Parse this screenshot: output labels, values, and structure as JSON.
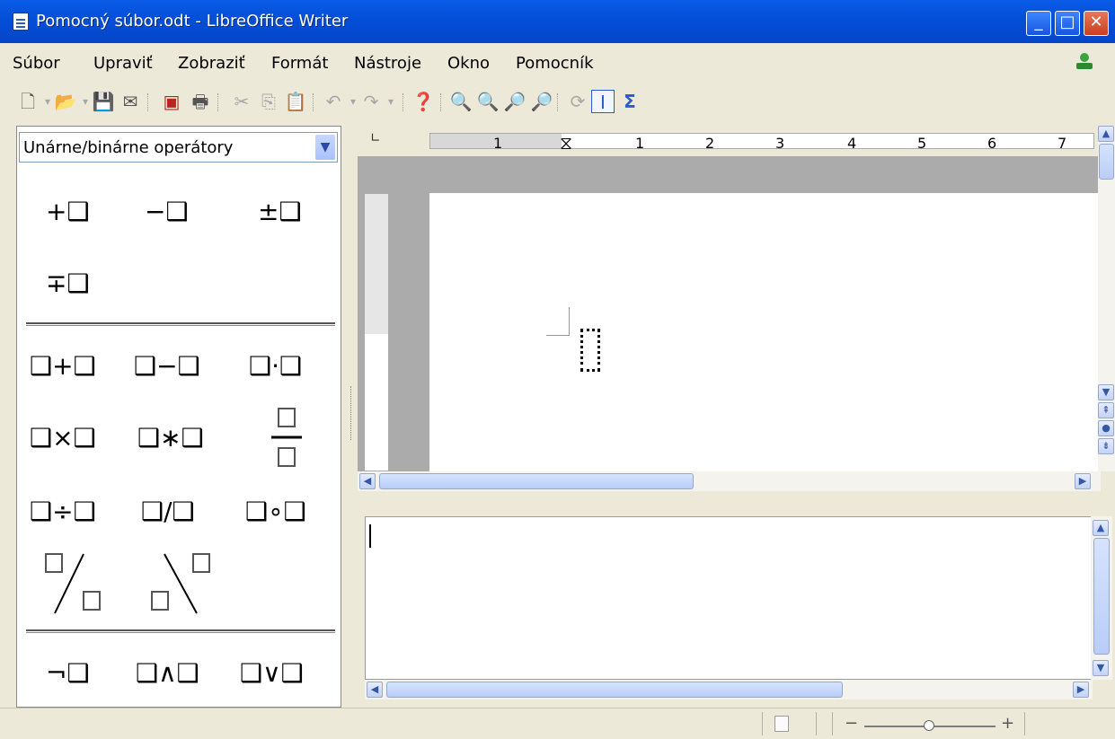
{
  "window": {
    "title": "Pomocný súbor.odt - LibreOffice Writer",
    "minimize": "_",
    "maximize": "□",
    "close": "✕"
  },
  "menu": [
    "Súbor",
    "Upraviť",
    "Zobraziť",
    "Formát",
    "Nástroje",
    "Okno",
    "Pomocník"
  ],
  "toolbar_icons": [
    "new-icon",
    "open-icon",
    "save-icon",
    "email-icon",
    "export-pdf-icon",
    "print-icon",
    "cut-icon",
    "copy-icon",
    "paste-icon",
    "undo-icon",
    "redo-icon",
    "help-icon",
    "zoom-in-icon",
    "zoom-out-icon",
    "zoom-100-icon",
    "zoom-page-icon",
    "update-icon",
    "formula-cursor-icon",
    "symbols-icon"
  ],
  "panel": {
    "category": "Unárne/binárne operátory",
    "unary": [
      "+❑",
      "−❑",
      "±❑",
      "∓❑"
    ],
    "binary": [
      "❑+❑",
      "❑−❑",
      "❑·❑",
      "❑×❑",
      "❑∗❑",
      "❑/❑",
      "❑÷❑",
      "❑∘❑"
    ],
    "logic": [
      "¬❑",
      "❑∧❑",
      "❑∨❑"
    ]
  },
  "ruler": {
    "h_labels": [
      "1",
      "1",
      "2",
      "3",
      "4",
      "5",
      "6",
      "7"
    ]
  },
  "statusbar": {
    "zoom_minus": "−",
    "zoom_plus": "+"
  }
}
